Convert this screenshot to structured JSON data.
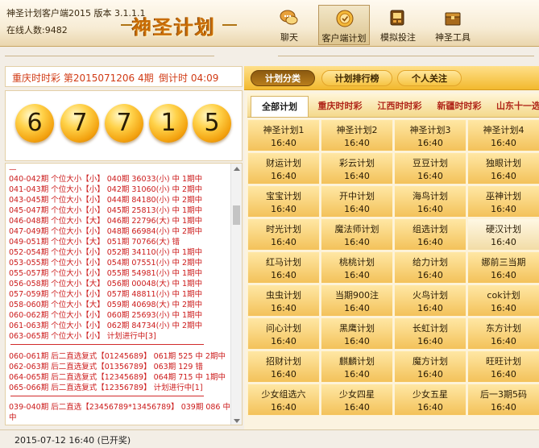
{
  "header": {
    "app_title": "神圣计划客户端2015 版本 3.1.1.1",
    "online": "在线人数:9482",
    "logo_text": "神圣计划",
    "nav": [
      {
        "label": "聊天",
        "icon": "chat-icon"
      },
      {
        "label": "客户端计划",
        "icon": "client-plan-icon"
      },
      {
        "label": "模拟投注",
        "icon": "simulate-bet-icon"
      },
      {
        "label": "神圣工具",
        "icon": "toolbox-icon"
      }
    ]
  },
  "left": {
    "issue": "重庆时时彩 第2015071206 4期",
    "countdown": "倒计时 04:09",
    "balls": [
      "6",
      "7",
      "7",
      "1",
      "5"
    ],
    "history_group1": [
      "040-042期 个位大小【小】 040期 36033(小) 中 1期中",
      "041-043期 个位大小【小】 042期 31060(小) 中 2期中",
      "043-045期 个位大小【小】 044期 84180(小) 中 2期中",
      "045-047期 个位大小【小】 045期 25813(小) 中 1期中",
      "046-048期 个位大小【大】 046期 22796(大) 中 1期中",
      "047-049期 个位大小【小】 048期 66984(小) 中 2期中",
      "049-051期 个位大小【大】 051期 70766(大) 错",
      "052-054期 个位大小【小】 052期 34110(小) 中 1期中",
      "053-055期 个位大小【小】 054期 07551(小) 中 2期中",
      "055-057期 个位大小【小】 055期 54981(小) 中 1期中",
      "056-058期 个位大小【大】 056期 00048(大) 中 1期中",
      "057-059期 个位大小【小】 057期 48811(小) 中 1期中",
      "058-060期 个位大小【大】 059期 40698(大) 中 2期中",
      "060-062期 个位大小【小】 060期 25693(小) 中 1期中",
      "061-063期 个位大小【小】 062期 84734(小) 中 2期中",
      "063-065期 个位大小【小】 计划进行中[3]"
    ],
    "history_group2": [
      "060-061期 后二直选复式【01245689】 061期 525 中 2期中",
      "062-063期 后二直选复式【01356789】 063期 129 错",
      "064-065期 后二直选复式【12345689】 064期 715 中 1期中",
      "065-066期 后二直选复式【12356789】 计划进行中[1]"
    ],
    "history_group3": [
      "039-040期 后二直选【23456789*13456789】 039期 086 中 1期",
      "中"
    ]
  },
  "status": "2015-07-12 16:40 (已开奖)",
  "right": {
    "top_tabs": [
      "计划分类",
      "计划排行榜",
      "个人关注"
    ],
    "sub_tabs": [
      "全部计划",
      "重庆时时彩",
      "江西时时彩",
      "新疆时时彩",
      "山东十一选五"
    ],
    "plans": [
      {
        "name": "神圣计划1",
        "time": "16:40"
      },
      {
        "name": "神圣计划2",
        "time": "16:40"
      },
      {
        "name": "神圣计划3",
        "time": "16:40"
      },
      {
        "name": "神圣计划4",
        "time": "16:40"
      },
      {
        "name": "财运计划",
        "time": "16:40"
      },
      {
        "name": "彩云计划",
        "time": "16:40"
      },
      {
        "name": "豆豆计划",
        "time": "16:40"
      },
      {
        "name": "独眼计划",
        "time": "16:40"
      },
      {
        "name": "宝宝计划",
        "time": "16:40"
      },
      {
        "name": "开中计划",
        "time": "16:40"
      },
      {
        "name": "海鸟计划",
        "time": "16:40"
      },
      {
        "name": "巫神计划",
        "time": "16:40"
      },
      {
        "name": "时光计划",
        "time": "16:40"
      },
      {
        "name": "魔法师计划",
        "time": "16:40"
      },
      {
        "name": "组选计划",
        "time": "16:40"
      },
      {
        "name": "硬汉计划",
        "time": "16:40"
      },
      {
        "name": "红马计划",
        "time": "16:40"
      },
      {
        "name": "桃桃计划",
        "time": "16:40"
      },
      {
        "name": "给力计划",
        "time": "16:40"
      },
      {
        "name": "娜前三当期",
        "time": "16:40"
      },
      {
        "name": "虫虫计划",
        "time": "16:40"
      },
      {
        "name": "当期900注",
        "time": "16:40"
      },
      {
        "name": "火鸟计划",
        "time": "16:40"
      },
      {
        "name": "cok计划",
        "time": "16:40"
      },
      {
        "name": "问心计划",
        "time": "16:40"
      },
      {
        "name": "黑鹰计划",
        "time": "16:40"
      },
      {
        "name": "长虹计划",
        "time": "16:40"
      },
      {
        "name": "东方计划",
        "time": "16:40"
      },
      {
        "name": "招财计划",
        "time": "16:40"
      },
      {
        "name": "麒麟计划",
        "time": "16:40"
      },
      {
        "name": "魔方计划",
        "time": "16:40"
      },
      {
        "name": "旺旺计划",
        "time": "16:40"
      },
      {
        "name": "少女组选六",
        "time": "16:40"
      },
      {
        "name": "少女四星",
        "time": "16:40"
      },
      {
        "name": "少女五星",
        "time": "16:40"
      },
      {
        "name": "后一3期5码",
        "time": "16:40"
      }
    ]
  }
}
